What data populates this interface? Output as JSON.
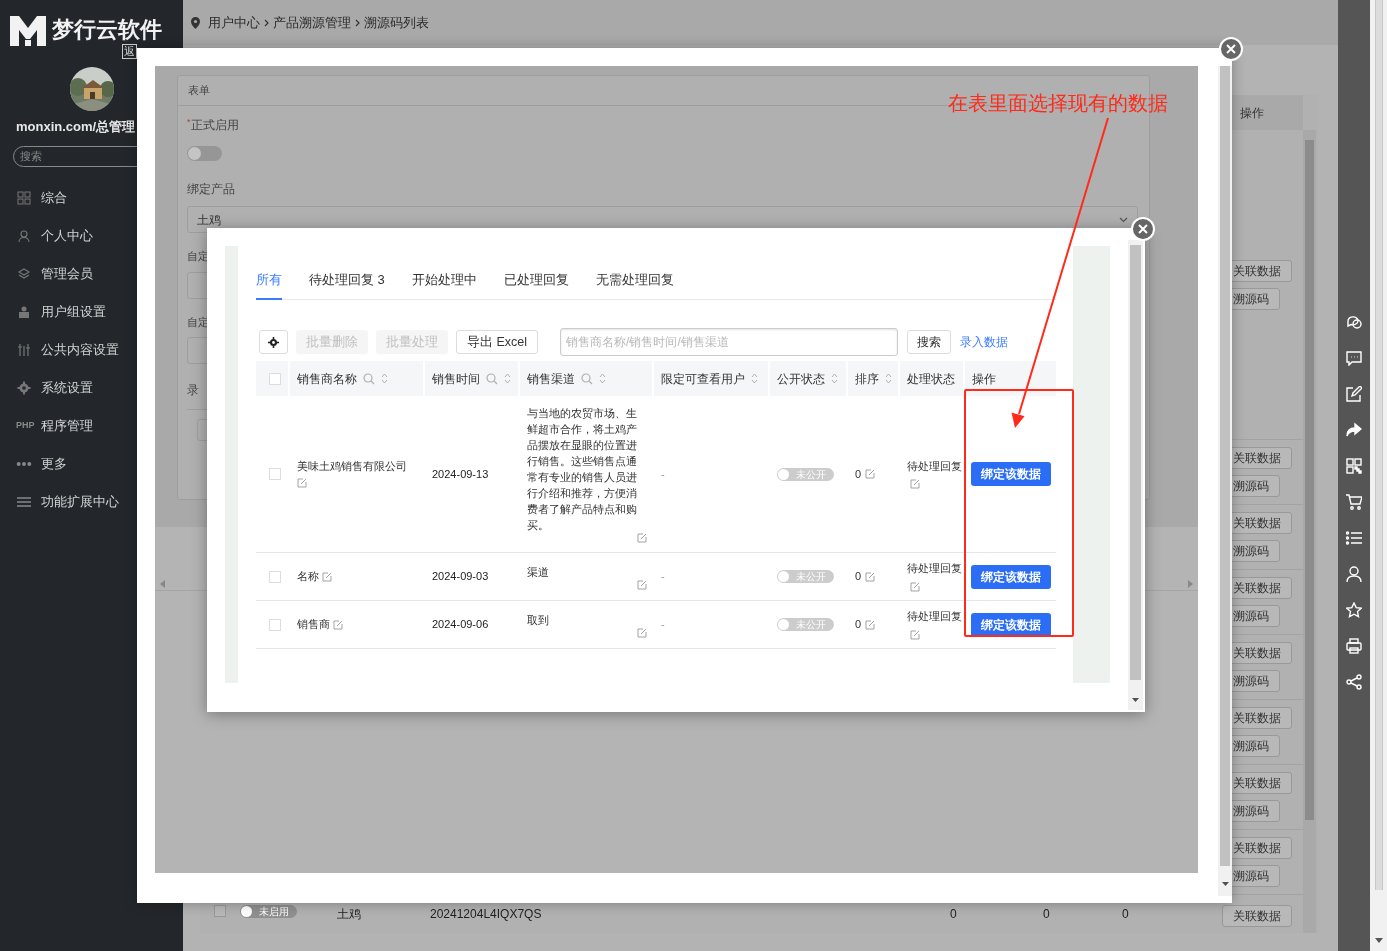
{
  "brand": {
    "name": "梦行云软件",
    "tag": "返"
  },
  "user": {
    "name": "monxin.com/总管理"
  },
  "sidebar": {
    "search_placeholder": "搜索",
    "items": [
      {
        "label": "综合"
      },
      {
        "label": "个人中心"
      },
      {
        "label": "管理会员"
      },
      {
        "label": "用户组设置"
      },
      {
        "label": "公共内容设置"
      },
      {
        "label": "系统设置"
      },
      {
        "label": "程序管理",
        "icon_text": "PHP"
      },
      {
        "label": "更多"
      },
      {
        "label": "功能扩展中心"
      }
    ]
  },
  "breadcrumb": [
    "用户中心",
    "产品溯源管理",
    "溯源码列表"
  ],
  "list": {
    "action_header": "操作",
    "rows": [
      {
        "actions": [
          "关联数据",
          "溯源码"
        ]
      },
      {
        "actions": [
          "关联数据",
          "溯源码"
        ]
      },
      {
        "actions": [
          "关联数据",
          "溯源码"
        ]
      },
      {
        "actions": [
          "关联数据",
          "溯源码"
        ]
      },
      {
        "actions": [
          "关联数据",
          "溯源码"
        ]
      },
      {
        "actions": [
          "关联数据",
          "溯源码"
        ]
      },
      {
        "actions": [
          "关联数据",
          "溯源码"
        ]
      },
      {
        "actions": [
          "关联数据",
          "溯源码"
        ]
      },
      {
        "checked": false,
        "toggle": {
          "label": "未启用",
          "on": false
        },
        "cells": [
          "土鸡",
          "20241204L4IQX7QS",
          "0",
          "0",
          "0"
        ],
        "actions": [
          "关联数据"
        ]
      }
    ]
  },
  "form_dialog": {
    "panel_title": "表单",
    "fields": [
      {
        "kind": "switch",
        "label": "正式启用",
        "required_mark": "*",
        "on": false
      },
      {
        "kind": "select",
        "label": "绑定产品",
        "value": "土鸡"
      },
      {
        "kind": "input",
        "label": "自定"
      },
      {
        "kind": "input",
        "label": "自定"
      },
      {
        "kind": "box",
        "label": "录"
      }
    ]
  },
  "picker_dialog": {
    "tabs": [
      {
        "label": "所有",
        "selected": true
      },
      {
        "label": "待处理回复 3",
        "selected": false
      },
      {
        "label": "开始处理中",
        "selected": false
      },
      {
        "label": "已处理回复",
        "selected": false
      },
      {
        "label": "无需处理回复",
        "selected": false
      }
    ],
    "toolbar": {
      "buttons": [
        {
          "label": "批量删除",
          "disabled": true
        },
        {
          "label": "批量处理",
          "disabled": true
        },
        {
          "label": "导出 Excel",
          "disabled": false
        }
      ],
      "search": {
        "placeholder": "销售商名称/销售时间/销售渠道"
      },
      "search_button": "搜索",
      "add_link": "录入数据"
    },
    "select_all": {
      "checked": false
    },
    "columns": [
      {
        "label": "销售商名称",
        "searchable": true,
        "sortable": true
      },
      {
        "label": "销售时间",
        "searchable": true,
        "sortable": true
      },
      {
        "label": "销售渠道",
        "searchable": true,
        "sortable": true
      },
      {
        "label": "限定可查看用户",
        "searchable": false,
        "sortable": true
      },
      {
        "label": "公开状态",
        "searchable": false,
        "sortable": true
      },
      {
        "label": "排序",
        "searchable": false,
        "sortable": true
      },
      {
        "label": "处理状态",
        "searchable": false,
        "sortable": false
      },
      {
        "label": "操作",
        "searchable": false,
        "sortable": false
      }
    ],
    "rows": [
      {
        "checked": false,
        "vendor": "美味土鸡销售有限公司",
        "date": "2024-09-13",
        "channel": "与当地的农贸市场、生鲜超市合作，将土鸡产品摆放在显眼的位置进行销售。这些销售点通常有专业的销售人员进行介绍和推荐，方便消费者了解产品特点和购买。",
        "viewers": "-",
        "public": {
          "label": "未公开",
          "on": false
        },
        "order": "0",
        "status": "待处理回复",
        "action": "绑定该数据"
      },
      {
        "checked": false,
        "vendor": "名称",
        "date": "2024-09-03",
        "channel": "渠道",
        "viewers": "-",
        "public": {
          "label": "未公开",
          "on": false
        },
        "order": "0",
        "status": "待处理回复",
        "action": "绑定该数据"
      },
      {
        "checked": false,
        "vendor": "销售商",
        "date": "2024-09-06",
        "channel": "取到",
        "viewers": "-",
        "public": {
          "label": "未公开",
          "on": false
        },
        "order": "0",
        "status": "待处理回复",
        "action": "绑定该数据"
      }
    ]
  },
  "annotation": {
    "text": "在表里面选择现有的数据"
  }
}
